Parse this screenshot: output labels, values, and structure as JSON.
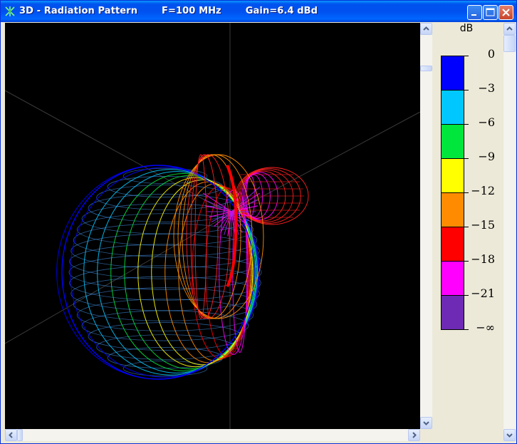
{
  "window": {
    "title": "3D - Radiation Pattern",
    "frequency": "F=100 MHz",
    "gain": "Gain=6.4 dBd"
  },
  "legend": {
    "unit": "dB",
    "levels": [
      {
        "label": "0",
        "color": "#0000FF"
      },
      {
        "label": "−3",
        "color": "#00C8FF"
      },
      {
        "label": "−6",
        "color": "#00E63C"
      },
      {
        "label": "−9",
        "color": "#FFFF00"
      },
      {
        "label": "−12",
        "color": "#FF8C00"
      },
      {
        "label": "−15",
        "color": "#FF0000"
      },
      {
        "label": "−18",
        "color": "#FF00FF"
      },
      {
        "label": "−21",
        "color": "#6E2AB4"
      }
    ],
    "bottom_label": "−∞"
  },
  "colors": {
    "titlebar": "#0053EE",
    "canvas_bg": "#000000",
    "panel_bg": "#ECE9D8"
  }
}
